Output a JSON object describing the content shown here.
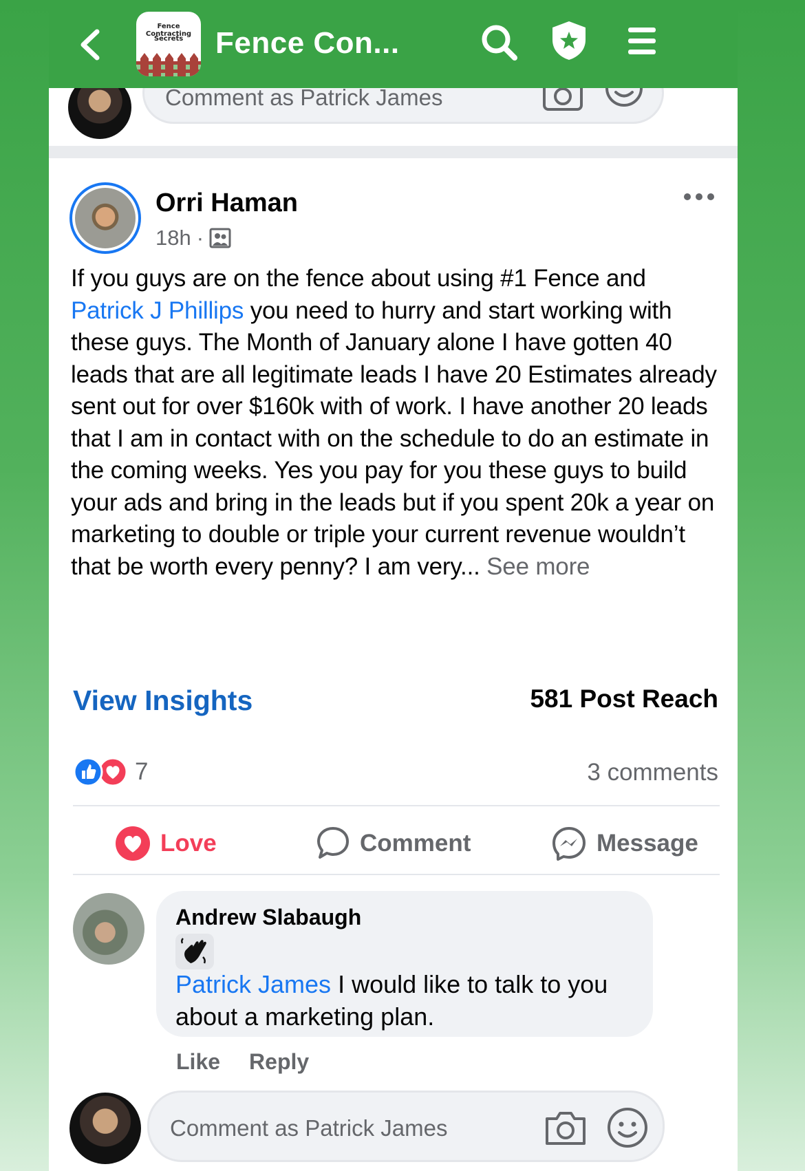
{
  "header": {
    "group_title": "Fence Con...",
    "logo_text_1": "Fence Contracting",
    "logo_text_2": "Secrets"
  },
  "composer": {
    "placeholder": "Comment as Patrick James"
  },
  "post": {
    "author": "Orri Haman",
    "time": "18h",
    "text_part1": "If you guys are on the fence about using #1 Fence and ",
    "mention": "Patrick J Phillips",
    "text_part2": " you need to hurry and start working with these guys. The Month of January alone I have gotten 40 leads that are all legitimate leads I have 20 Estimates already sent out for over $160k with of work. I have another 20 leads that I am in contact with on the schedule to do an estimate in the coming weeks. Yes you pay for you these guys to build your ads and bring in the leads but if you spent 20k a year on marketing to double or triple your current revenue wouldn’t that be worth every penny? I am very... ",
    "see_more": "See more",
    "view_insights": "View Insights",
    "post_reach": "581 Post Reach",
    "reaction_count": "7",
    "comments_count": "3 comments"
  },
  "actions": {
    "love": "Love",
    "comment": "Comment",
    "message": "Message"
  },
  "comment": {
    "author": "Andrew Slabaugh",
    "mention": "Patrick James",
    "text": " I would like to talk to you about a marketing plan.",
    "like": "Like",
    "reply": "Reply"
  },
  "colors": {
    "header_green": "#3aa346",
    "link_blue": "#1877f2",
    "love_red": "#f33e58"
  }
}
